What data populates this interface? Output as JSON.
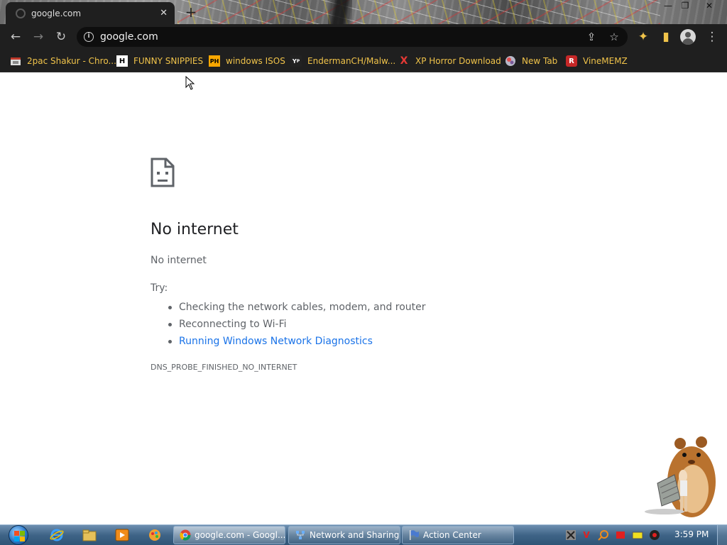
{
  "browser": {
    "tab": {
      "title": "google.com",
      "close": "✕"
    },
    "new_tab": "+",
    "window_controls": {
      "minimize": "—",
      "maximize": "❐",
      "close": "✕"
    }
  },
  "toolbar": {
    "back": "←",
    "forward": "→",
    "reload": "↻",
    "url": "google.com",
    "share": "⇪",
    "bookmark_star": "☆",
    "extensions": "✦",
    "side_panel": "▮",
    "menu": "⋮"
  },
  "bookmarks": [
    {
      "label": "2pac Shakur - Chro...",
      "icon": "tab-icon"
    },
    {
      "label": "FUNNY SNIPPIES",
      "icon": "H"
    },
    {
      "label": "windows ISOS",
      "icon": "PH"
    },
    {
      "label": "EndermanCH/Malw...",
      "icon": "YP"
    },
    {
      "label": "XP Horror Download",
      "icon": "X"
    },
    {
      "label": "New Tab",
      "icon": "globe"
    },
    {
      "label": "VineMEMZ",
      "icon": "R"
    }
  ],
  "error_page": {
    "title": "No internet",
    "subtitle": "No internet",
    "try_label": "Try:",
    "suggestions": [
      "Checking the network cables, modem, and router",
      "Reconnecting to Wi-Fi",
      "Running Windows Network Diagnostics"
    ],
    "error_code": "DNS_PROBE_FINISHED_NO_INTERNET"
  },
  "taskbar": {
    "tasks": [
      {
        "label": "google.com - Googl...",
        "active": true
      },
      {
        "label": "Network and Sharing...",
        "active": false
      },
      {
        "label": "Action Center",
        "active": false
      }
    ],
    "clock": "3:59 PM"
  },
  "colors": {
    "browser_dark": "#1f1f1f",
    "bookmark_text": "#f0c34a",
    "link": "#1a73e8",
    "body_text": "#5f6368",
    "taskbar": "#3f6487"
  }
}
